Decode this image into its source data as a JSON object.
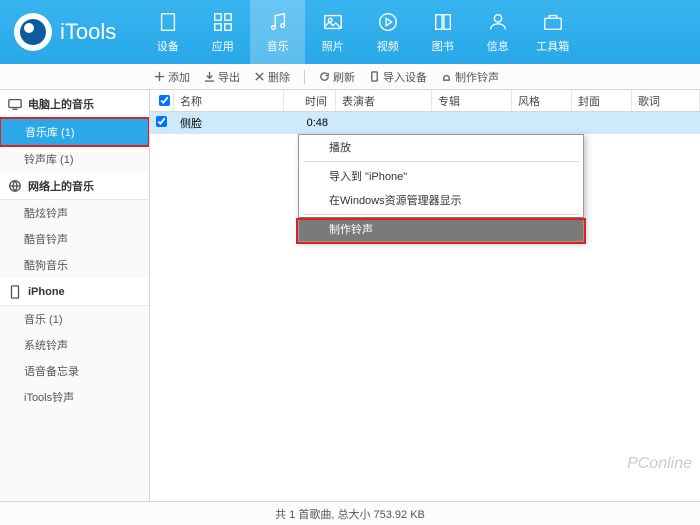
{
  "logo_text": "iTools",
  "nav": [
    {
      "label": "设备",
      "icon": "device"
    },
    {
      "label": "应用",
      "icon": "apps"
    },
    {
      "label": "音乐",
      "icon": "music",
      "active": true
    },
    {
      "label": "照片",
      "icon": "photo"
    },
    {
      "label": "视频",
      "icon": "video"
    },
    {
      "label": "图书",
      "icon": "book"
    },
    {
      "label": "信息",
      "icon": "info"
    },
    {
      "label": "工具箱",
      "icon": "toolbox"
    }
  ],
  "toolbar": {
    "add": "添加",
    "export": "导出",
    "delete": "删除",
    "refresh": "刷新",
    "import_device": "导入设备",
    "make_ringtone": "制作铃声"
  },
  "sidebar": {
    "g1": {
      "title": "电脑上的音乐",
      "items": [
        {
          "label": "音乐库 (1)",
          "active": true,
          "highlight": true
        },
        {
          "label": "铃声库 (1)"
        }
      ]
    },
    "g2": {
      "title": "网络上的音乐",
      "items": [
        {
          "label": "酷炫铃声"
        },
        {
          "label": "酷音铃声"
        },
        {
          "label": "酷狗音乐"
        }
      ]
    },
    "g3": {
      "title": "iPhone",
      "items": [
        {
          "label": "音乐 (1)"
        },
        {
          "label": "系统铃声"
        },
        {
          "label": "语音备忘录"
        },
        {
          "label": "iTools铃声"
        }
      ]
    }
  },
  "columns": {
    "name": "名称",
    "time": "时间",
    "artist": "表演者",
    "album": "专辑",
    "genre": "风格",
    "cover": "封面",
    "lyric": "歌词"
  },
  "row": {
    "name": "侧脸",
    "time": "0:48"
  },
  "context_menu": {
    "play": "播放",
    "import_iphone": "导入到 \"iPhone\"",
    "show_explorer": "在Windows资源管理器显示",
    "make_ringtone": "制作铃声"
  },
  "status": "共 1 首歌曲, 总大小 753.92 KB",
  "watermark": "PConline"
}
